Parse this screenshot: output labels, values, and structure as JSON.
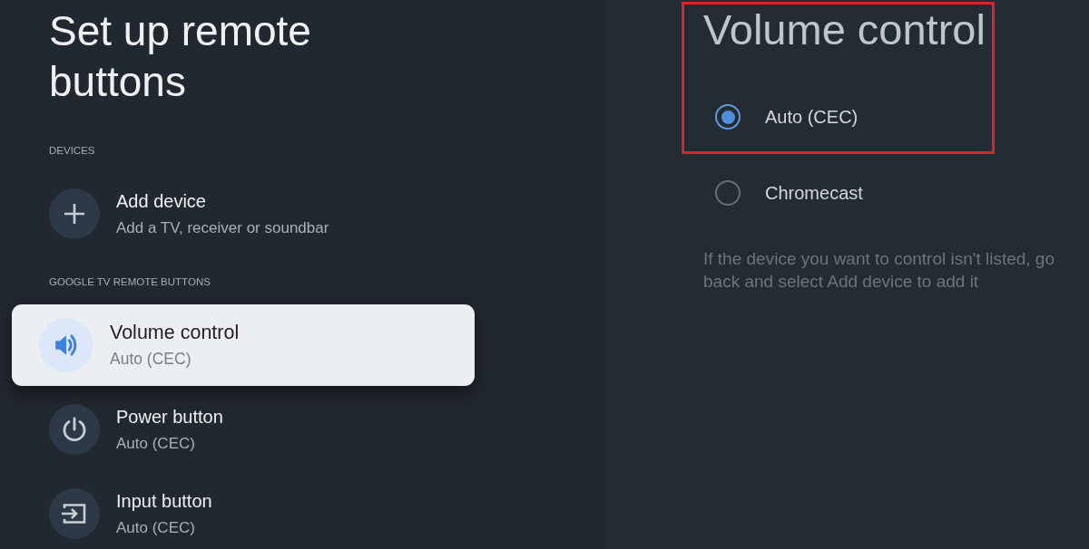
{
  "left": {
    "title": "Set up remote buttons",
    "sections": [
      {
        "heading": "DEVICES",
        "items": [
          {
            "kind": "add",
            "title": "Add device",
            "subtitle": "Add a TV, receiver or soundbar",
            "selected": false
          }
        ]
      },
      {
        "heading": "GOOGLE TV REMOTE BUTTONS",
        "items": [
          {
            "kind": "volume",
            "title": "Volume control",
            "subtitle": "Auto (CEC)",
            "selected": true
          },
          {
            "kind": "power",
            "title": "Power button",
            "subtitle": "Auto (CEC)",
            "selected": false
          },
          {
            "kind": "input",
            "title": "Input button",
            "subtitle": "Auto (CEC)",
            "selected": false
          }
        ]
      }
    ]
  },
  "detail": {
    "title": "Volume control",
    "highlighted": true,
    "options": [
      {
        "label": "Auto (CEC)",
        "selected": true
      },
      {
        "label": "Chromecast",
        "selected": false
      }
    ],
    "note": "If the device you want to control isn't listed, go back and select Add device to add it"
  }
}
